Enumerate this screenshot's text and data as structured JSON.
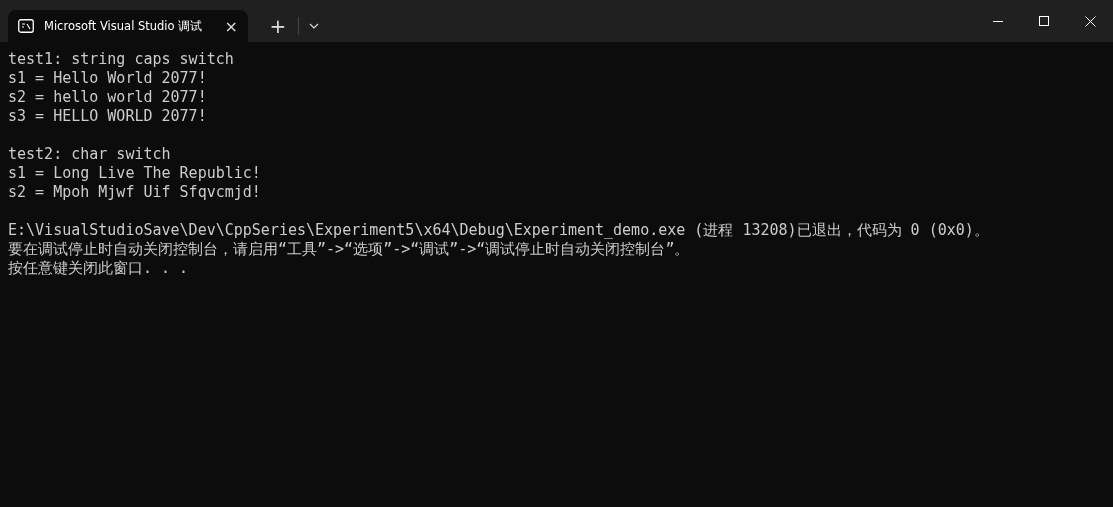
{
  "tab": {
    "title": "Microsoft Visual Studio 调试",
    "selected": true,
    "close": "×"
  },
  "new_tab": "+",
  "console": {
    "blocks": [
      [
        "test1: string caps switch",
        "s1 = Hello World 2077!",
        "s2 = hello world 2077!",
        "s3 = HELLO WORLD 2077!"
      ],
      [
        "test2: char switch",
        "s1 = Long Live The Republic!",
        "s2 = Mpoh Mjwf Uif Sfqvcmjd!"
      ],
      [
        "E:\\VisualStudioSave\\Dev\\CppSeries\\Experiment5\\x64\\Debug\\Experiment_demo.exe (进程 13208)已退出，代码为 0 (0x0)。",
        "要在调试停止时自动关闭控制台，请启用“工具”->“选项”->“调试”->“调试停止时自动关闭控制台”。",
        "按任意键关闭此窗口. . ."
      ]
    ]
  }
}
